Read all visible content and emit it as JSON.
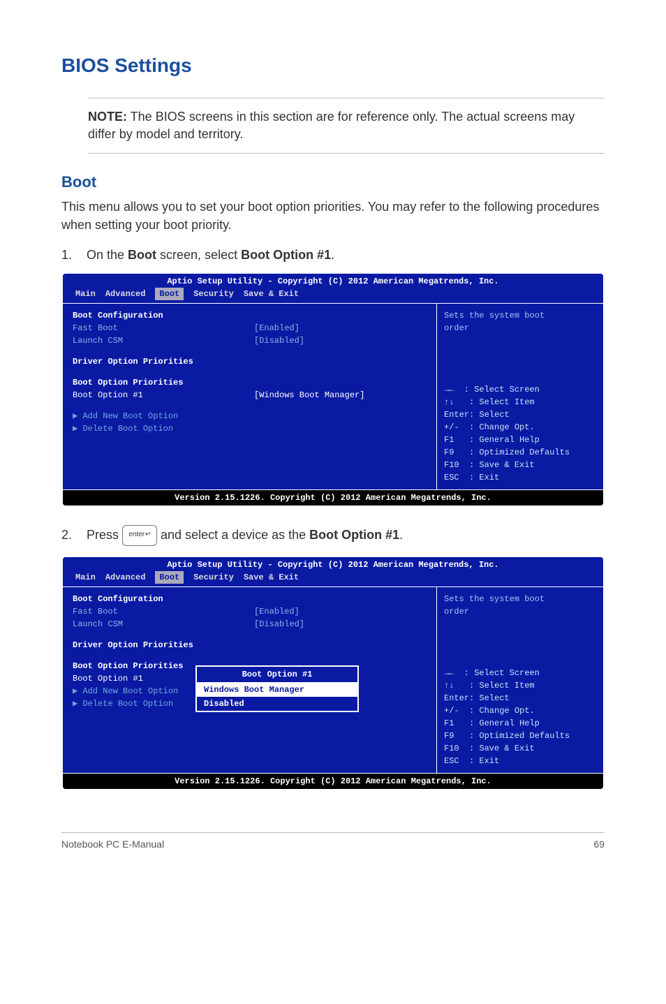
{
  "headings": {
    "main": "BIOS Settings",
    "sub": "Boot"
  },
  "note": {
    "label": "NOTE:",
    "text": " The BIOS screens in this section are for reference only. The actual screens may differ by model and territory."
  },
  "intro": "This menu allows you to set your boot option priorities. You may refer to the following procedures when setting your boot priority.",
  "steps": {
    "s1_num": "1.",
    "s1_a": "On the ",
    "s1_b": "Boot",
    "s1_c": " screen, select ",
    "s1_d": "Boot Option #1",
    "s1_e": ".",
    "s2_num": "2.",
    "s2_a": "Press ",
    "s2_b": " and select a device as the ",
    "s2_c": "Boot Option #1",
    "s2_d": ".",
    "enter_key": "enter↵"
  },
  "bios_common": {
    "header": "Aptio Setup Utility - Copyright (C) 2012 American Megatrends, Inc.",
    "footer": "Version 2.15.1226. Copyright (C) 2012 American Megatrends, Inc.",
    "tabs": {
      "main": "Main",
      "advanced": "Advanced",
      "boot": "Boot",
      "security": "Security",
      "saveexit": "Save & Exit"
    },
    "left": {
      "boot_conf": "Boot Configuration",
      "fast_boot": "Fast Boot",
      "fast_boot_val": "[Enabled]",
      "launch_csm": "Launch CSM",
      "launch_csm_val": "[Disabled]",
      "driver_prio": "Driver Option Priorities",
      "boot_prio": "Boot Option Priorities",
      "boot_opt1": "Boot Option #1",
      "boot_opt1_val": "[Windows Boot Manager]",
      "add_new": "Add New Boot Option",
      "delete_opt": "Delete Boot Option",
      "add_arrow": "▶",
      "del_arrow": "▶"
    },
    "right": {
      "help": "Sets the system boot\norder",
      "k1": "→←  : Select Screen",
      "k2": "↑↓   : Select Item",
      "k3": "Enter: Select",
      "k4": "+/-  : Change Opt.",
      "k5": "F1   : General Help",
      "k6": "F9   : Optimized Defaults",
      "k7": "F10  : Save & Exit",
      "k8": "ESC  : Exit"
    }
  },
  "popup": {
    "title": "Boot Option #1",
    "opt1": "Windows Boot Manager",
    "opt2": "Disabled"
  },
  "footer": {
    "left": "Notebook PC E-Manual",
    "right": "69"
  }
}
